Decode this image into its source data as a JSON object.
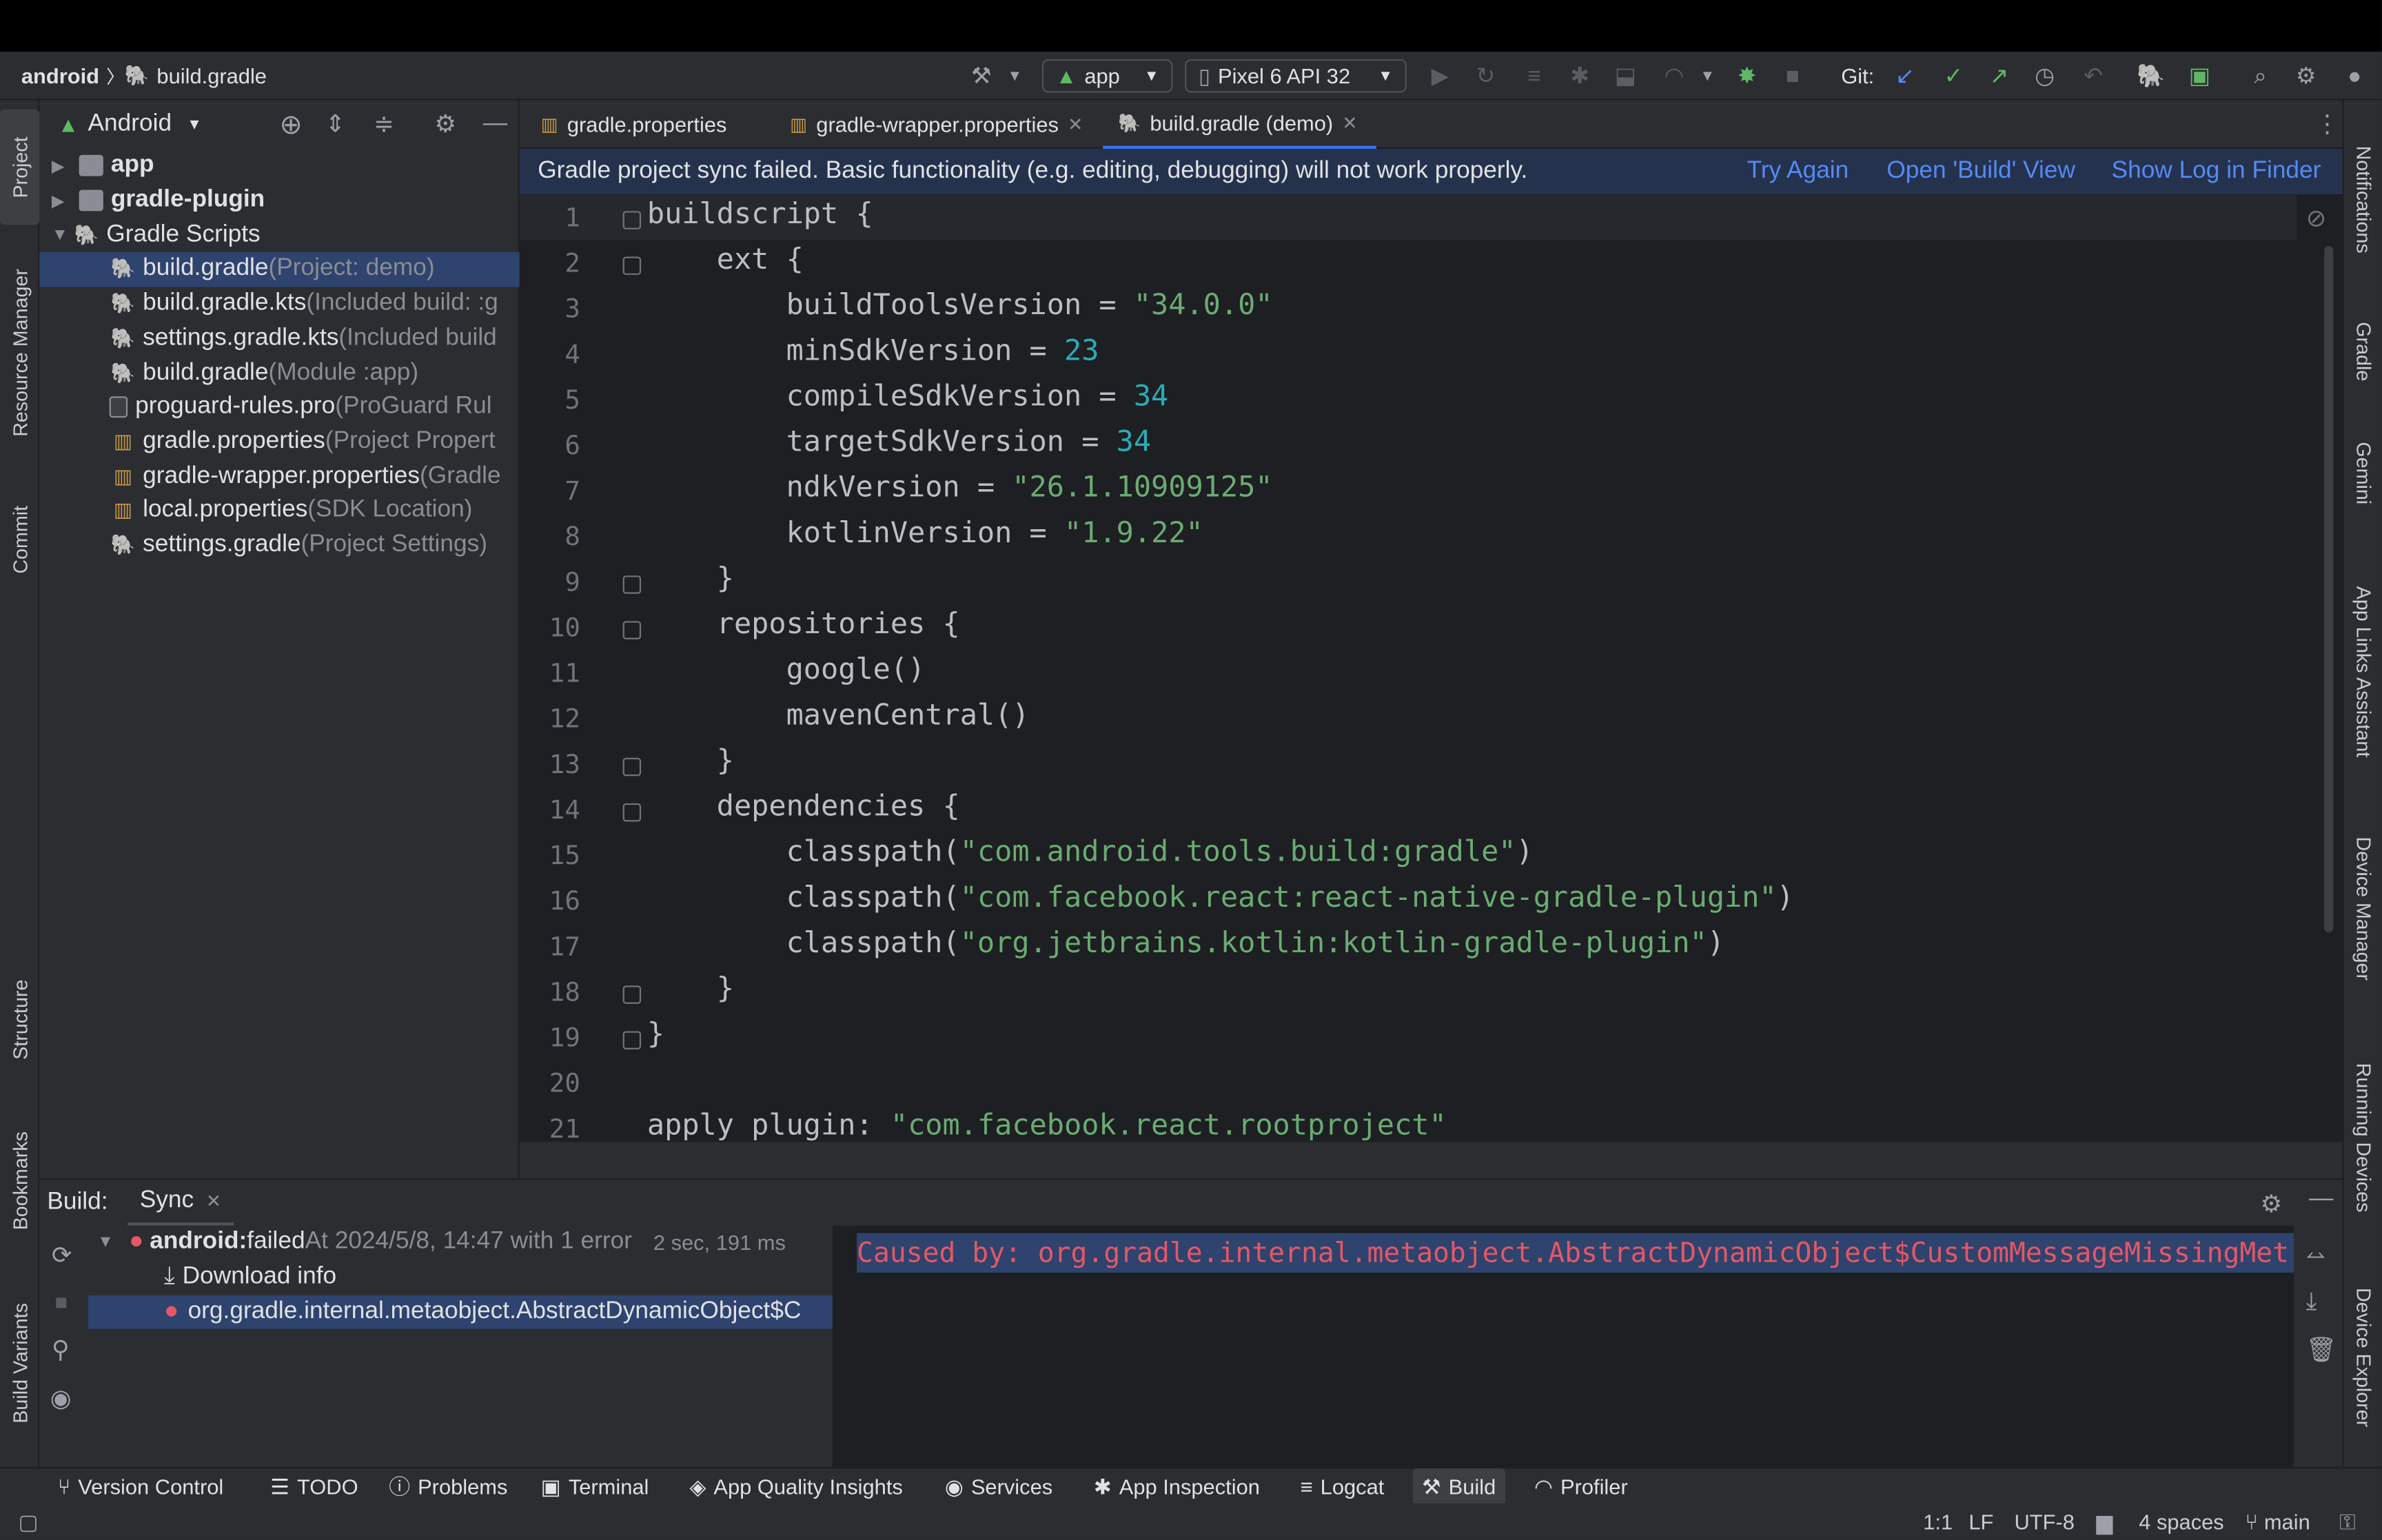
{
  "toolbar": {
    "breadcrumb_root": "android",
    "breadcrumb_file": "build.gradle",
    "run_config": "app",
    "device": "Pixel 6 API 32",
    "git_label": "Git:"
  },
  "left_stripe": [
    "Project",
    "Resource Manager",
    "Commit",
    "Structure",
    "Bookmarks",
    "Build Variants"
  ],
  "right_stripe": [
    "Notifications",
    "Gradle",
    "Gemini",
    "App Links Assistant",
    "Device Manager",
    "Running Devices",
    "Device Explorer"
  ],
  "project": {
    "view": "Android",
    "items": [
      {
        "name": "app",
        "hint": "",
        "icon": "folder-icon",
        "level": 0
      },
      {
        "name": "gradle-plugin",
        "hint": "",
        "icon": "folder-icon",
        "level": 0
      },
      {
        "name": "Gradle Scripts",
        "hint": "",
        "icon": "gradle-elephant-icon",
        "level": 0
      },
      {
        "name": "build.gradle",
        "hint": " (Project: demo)",
        "icon": "gradle-elephant-icon",
        "level": 1
      },
      {
        "name": "build.gradle.kts",
        "hint": " (Included build: :g",
        "icon": "gradle-kts-icon",
        "level": 1
      },
      {
        "name": "settings.gradle.kts",
        "hint": " (Included build",
        "icon": "gradle-kts-icon",
        "level": 1
      },
      {
        "name": "build.gradle",
        "hint": " (Module :app)",
        "icon": "gradle-elephant-icon",
        "level": 1
      },
      {
        "name": "proguard-rules.pro",
        "hint": " (ProGuard Rul",
        "icon": "file-icon",
        "level": 1
      },
      {
        "name": "gradle.properties",
        "hint": " (Project Propert",
        "icon": "properties-icon",
        "level": 1
      },
      {
        "name": "gradle-wrapper.properties",
        "hint": " (Gradle",
        "icon": "properties-icon",
        "level": 1
      },
      {
        "name": "local.properties",
        "hint": " (SDK Location)",
        "icon": "properties-icon",
        "level": 1
      },
      {
        "name": "settings.gradle",
        "hint": " (Project Settings)",
        "icon": "gradle-elephant-icon",
        "level": 1
      }
    ]
  },
  "tabs": [
    {
      "label": "gradle.properties"
    },
    {
      "label": "gradle-wrapper.properties"
    },
    {
      "label": "build.gradle (demo)"
    }
  ],
  "banner": {
    "message": "Gradle project sync failed. Basic functionality (e.g. editing, debugging) will not work properly.",
    "try_again": "Try Again",
    "open_build": "Open 'Build' View",
    "show_log": "Show Log in Finder"
  },
  "code_lines": [
    "buildscript {",
    "    ext {",
    "        buildToolsVersion = \"34.0.0\"",
    "        minSdkVersion = 23",
    "        compileSdkVersion = 34",
    "        targetSdkVersion = 34",
    "        ndkVersion = \"26.1.10909125\"",
    "        kotlinVersion = \"1.9.22\"",
    "    }",
    "    repositories {",
    "        google()",
    "        mavenCentral()",
    "    }",
    "    dependencies {",
    "        classpath(\"com.android.tools.build:gradle\")",
    "        classpath(\"com.facebook.react:react-native-gradle-plugin\")",
    "        classpath(\"org.jetbrains.kotlin:kotlin-gradle-plugin\")",
    "    }",
    "}",
    "",
    "apply plugin: \"com.facebook.react.rootproject\""
  ],
  "build": {
    "label": "Build:",
    "tab": "Sync",
    "root_name": "android:",
    "root_status": " failed",
    "root_time": " At 2024/5/8, 14:47 with 1 error",
    "root_duration": "2 sec, 191 ms",
    "download": "Download info",
    "error_item": "org.gradle.internal.metaobject.AbstractDynamicObject$C",
    "output": "Caused by: org.gradle.internal.metaobject.AbstractDynamicObject$CustomMessageMissingMet"
  },
  "bottom_tabs": [
    "Version Control",
    "TODO",
    "Problems",
    "Terminal",
    "App Quality Insights",
    "Services",
    "App Inspection",
    "Logcat",
    "Build",
    "Profiler"
  ],
  "status": {
    "position": "1:1",
    "line_sep": "LF",
    "encoding": "UTF-8",
    "indent": "4 spaces",
    "branch": "main"
  },
  "colors": {
    "accent": "#3574f0",
    "error": "#e55765",
    "string": "#6aab73",
    "number": "#2aacb8",
    "link": "#548af7"
  }
}
